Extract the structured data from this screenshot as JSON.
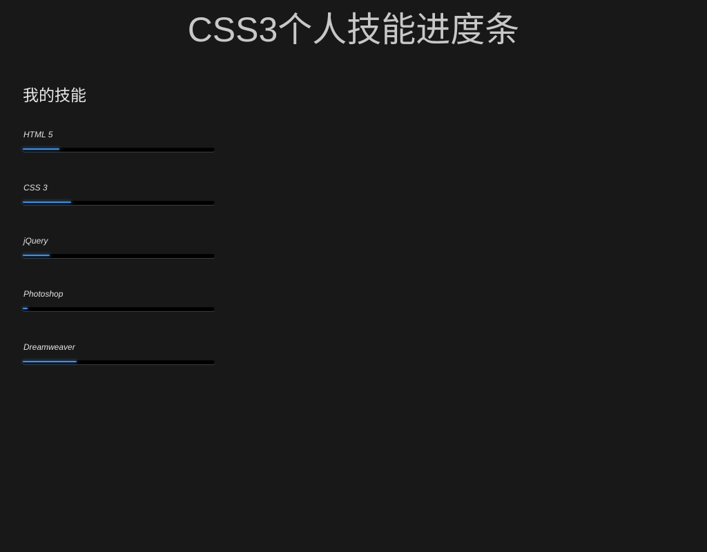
{
  "page": {
    "title": "CSS3个人技能进度条"
  },
  "section": {
    "heading": "我的技能"
  },
  "colors": {
    "background": "#181818",
    "fill": "#4a8fd6",
    "track": "#000000"
  },
  "skills": [
    {
      "label": "HTML 5",
      "progress": 19
    },
    {
      "label": "CSS 3",
      "progress": 25
    },
    {
      "label": "jQuery",
      "progress": 14
    },
    {
      "label": "Photoshop",
      "progress": 2.5
    },
    {
      "label": "Dreamweaver",
      "progress": 28
    }
  ]
}
